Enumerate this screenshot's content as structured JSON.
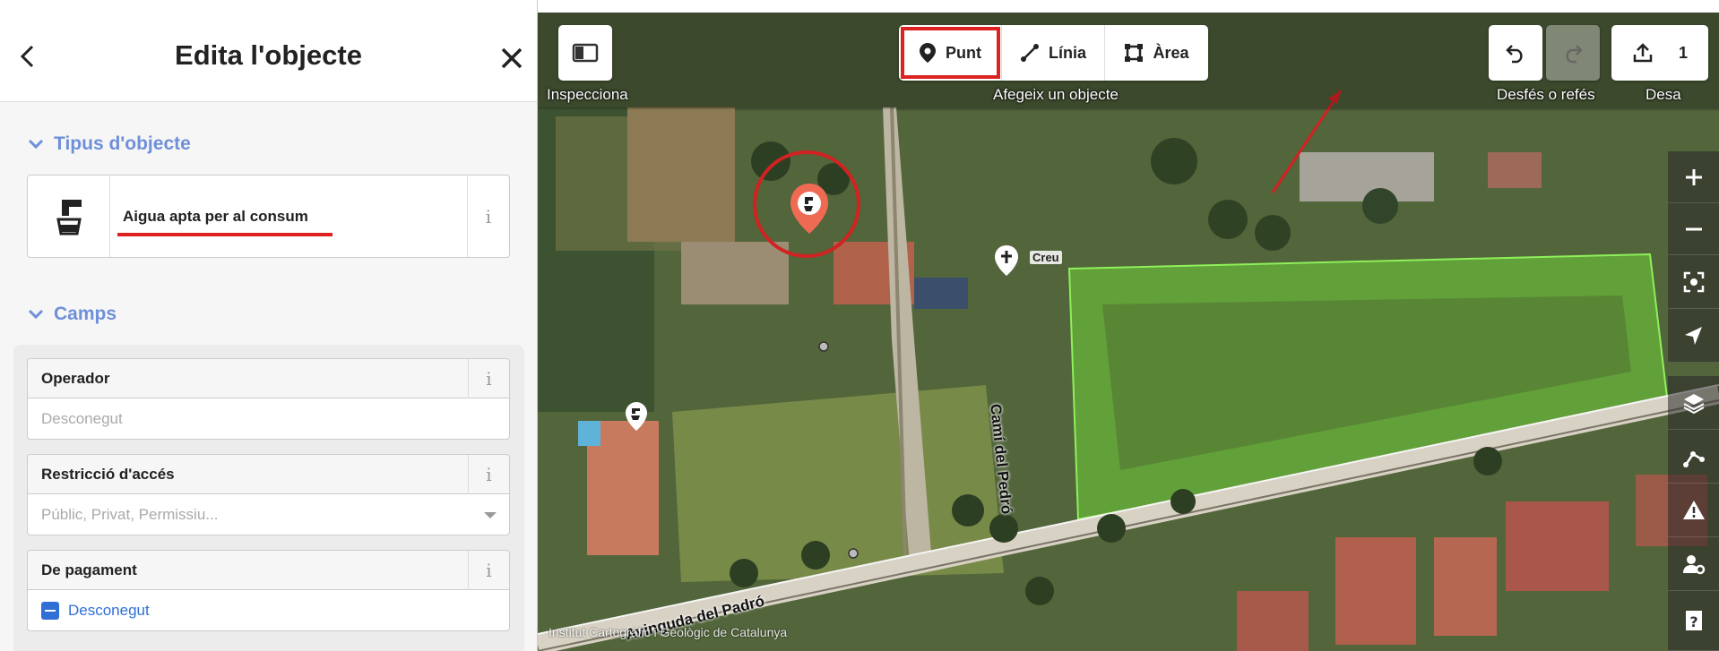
{
  "sidebar": {
    "title": "Edita l'objecte",
    "preset_section": "Tipus d'objecte",
    "preset_name": "Aigua apta per al consum",
    "fields_section": "Camps",
    "fields": [
      {
        "label": "Operador",
        "placeholder": "Desconegut"
      },
      {
        "label": "Restricció d'accés",
        "placeholder": "Públic, Privat, Permissiu..."
      },
      {
        "label": "De pagament",
        "value": "Desconegut"
      }
    ]
  },
  "toolbar": {
    "inspect_label": "Inspecciona",
    "modes": [
      {
        "label": "Punt",
        "icon": "marker-icon",
        "active": true
      },
      {
        "label": "Línia",
        "icon": "line-icon",
        "active": false
      },
      {
        "label": "Àrea",
        "icon": "area-icon",
        "active": false
      }
    ],
    "add_feature_label": "Afegeix un objecte",
    "undo_redo_label": "Desfés o refés",
    "save_count": "1",
    "save_label": "Desa"
  },
  "map": {
    "road_1": "Camí del Pedró",
    "road_2": "Avinguda del Padró",
    "pin_label": "Creu",
    "attribution": "Institut Cartogràfic i Geològic de Catalunya",
    "accent_color": "#d22222",
    "area_color": "#6fd13b"
  },
  "controls": [
    "zoom-in-icon",
    "zoom-out-icon",
    "zoom-to-selection-icon",
    "geolocate-icon",
    "layers-icon",
    "map-data-icon",
    "issues-icon",
    "preferences-icon",
    "help-icon"
  ]
}
